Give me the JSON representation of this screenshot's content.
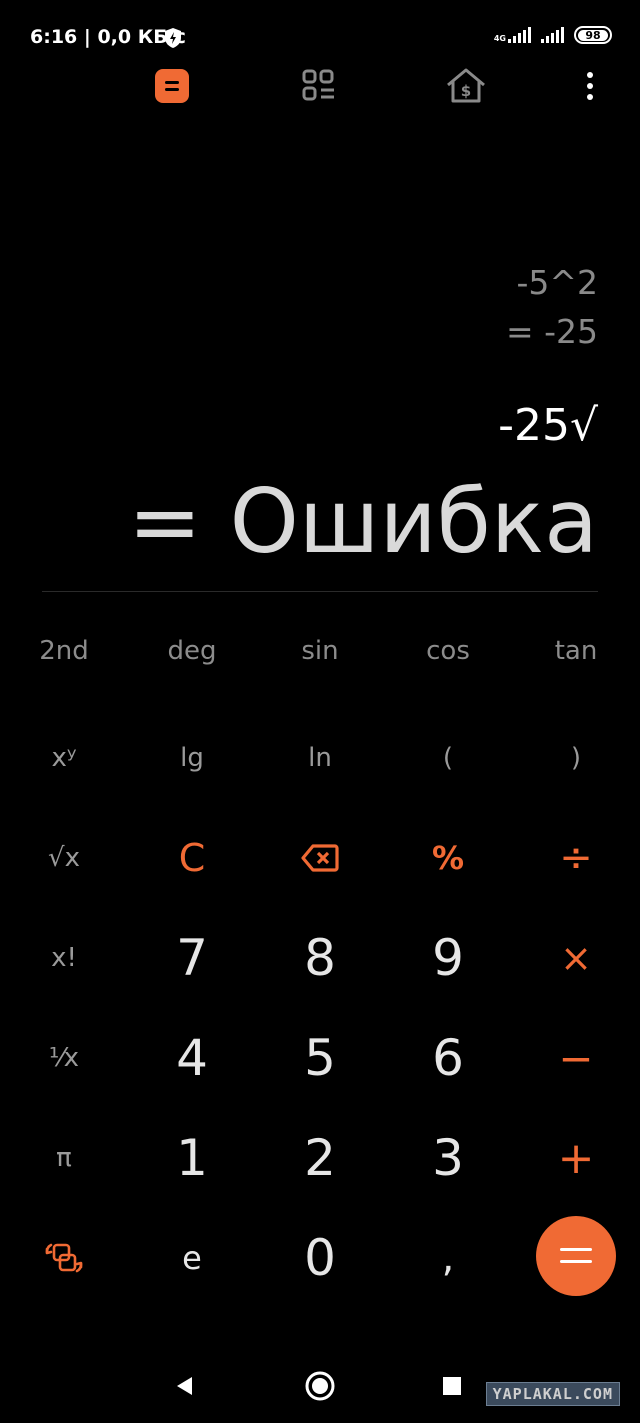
{
  "status_bar": {
    "time": "6:16",
    "network_speed": "| 0,0 КБ/с",
    "net_type": "4G",
    "battery": "98"
  },
  "top_icons": [
    "calculator-icon",
    "converter-grid-icon",
    "currency-icon",
    "more-icon"
  ],
  "display": {
    "history_expr": "-5^2",
    "history_result": "= -25",
    "expression": "-25√",
    "result": "= Ошибка"
  },
  "keypad": {
    "sci_row": [
      "2nd",
      "deg",
      "sin",
      "cos",
      "tan"
    ],
    "row2": [
      "xʸ",
      "lg",
      "ln",
      "(",
      ")"
    ],
    "row3": [
      "√x",
      "C",
      "",
      "%",
      "÷"
    ],
    "row4": [
      "x!",
      "7",
      "8",
      "9",
      "×"
    ],
    "row5": [
      "¹⁄x",
      "4",
      "5",
      "6",
      "−"
    ],
    "row6": [
      "π",
      "1",
      "2",
      "3",
      "+"
    ],
    "row7": [
      "",
      "e",
      "0",
      ",",
      "="
    ]
  },
  "colors": {
    "accent": "#f06a34",
    "background": "#000000"
  },
  "watermark": "YAPLAKAL.COM"
}
